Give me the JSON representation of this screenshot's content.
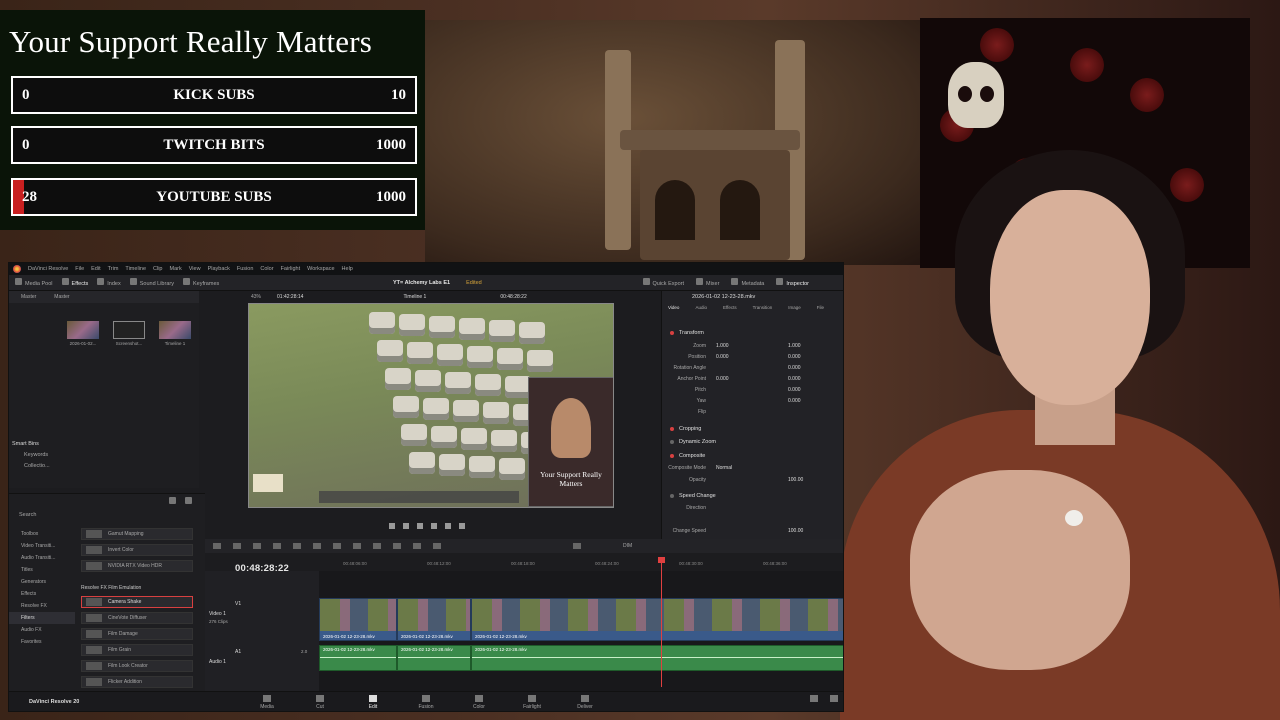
{
  "overlay": {
    "title": "Your Support Really Matters",
    "goals": [
      {
        "current": "0",
        "label": "KICK SUBS",
        "max": "10",
        "progress": 0.0
      },
      {
        "current": "0",
        "label": "TWITCH BITS",
        "max": "1000",
        "progress": 0.0
      },
      {
        "current": "28",
        "label": "YOUTUBE SUBS",
        "max": "1000",
        "progress": 0.028
      }
    ],
    "accent": "#c82020"
  },
  "resolve": {
    "menu": [
      "DaVinci Resolve",
      "File",
      "Edit",
      "Trim",
      "Timeline",
      "Clip",
      "Mark",
      "View",
      "Playback",
      "Fusion",
      "Color",
      "Fairlight",
      "Workspace",
      "Help"
    ],
    "toolbar_left": [
      "Media Pool",
      "Effects",
      "Index",
      "Sound Library",
      "Keyframes"
    ],
    "project": "YT= Alchemy Labs E1",
    "project_status": "Edited",
    "toolbar_right": [
      "Quick Export",
      "Mixer",
      "Metadata",
      "Inspector"
    ],
    "viewer": {
      "zoom": "43%",
      "source_tc": "01:42:28:14",
      "timeline": "Timeline 1",
      "tc": "00:48:28:22"
    },
    "pool_tabs": [
      "Master",
      "Master"
    ],
    "clips": [
      "2026-01-02...",
      "Screenshot...",
      "Timeline 1"
    ],
    "smart_bins": {
      "title": "Smart Bins",
      "items": [
        "Keywords",
        "Collectio..."
      ]
    },
    "effects": {
      "search_placeholder": "Search",
      "categories": [
        "Toolbox",
        "Video Transiti...",
        "Audio Transiti...",
        "Titles",
        "Generators",
        "Effects",
        "Resolve FX",
        "Filters",
        "Audio FX",
        "Favorites"
      ],
      "group": "Resolve FX Film Emulation",
      "items_top": [
        "Gamut Mapping",
        "Invert Color",
        "NVIDIA RTX Video HDR"
      ],
      "items": [
        "Camera Shake",
        "CineVote Diffuser",
        "Film Damage",
        "Film Grain",
        "Film Look Creator",
        "Flicker Addition"
      ]
    },
    "inspector": {
      "file": "2026-01-02 12-23-28.mkv",
      "tabs": [
        "Video",
        "Audio",
        "Effects",
        "Transition",
        "Image",
        "File"
      ],
      "sections": [
        "Transform",
        "Cropping",
        "Dynamic Zoom",
        "Composite",
        "Speed Change"
      ],
      "rows": [
        {
          "k": "Zoom",
          "x": "1.000",
          "y": "1.000"
        },
        {
          "k": "Position",
          "x": "0.000",
          "y": "0.000"
        },
        {
          "k": "Rotation Angle",
          "x": "",
          "y": "0.000"
        },
        {
          "k": "Anchor Point",
          "x": "0.000",
          "y": "0.000"
        },
        {
          "k": "Pitch",
          "x": "",
          "y": "0.000"
        },
        {
          "k": "Yaw",
          "x": "",
          "y": "0.000"
        },
        {
          "k": "Flip",
          "x": "",
          "y": ""
        }
      ],
      "composite_mode_label": "Composite Mode",
      "composite_mode": "Normal",
      "opacity_label": "Opacity",
      "opacity": "100.00",
      "direction_label": "Direction",
      "change_speed_label": "Change Speed",
      "change_speed": "100.00"
    },
    "timeline": {
      "tc": "00:48:28:22",
      "ruler": [
        "00:48:06:00",
        "00:48:12:00",
        "00:48:18:00",
        "00:48:24:00",
        "00:48:30:00",
        "00:48:36:00"
      ],
      "video_track": {
        "id": "V1",
        "name": "Video 1",
        "clips": "276 Clips"
      },
      "audio_track": {
        "id": "A1",
        "name": "Audio 1",
        "level": "2.0"
      },
      "clip_name": "2026-01-02 12-23-28.mkv",
      "dim": "DIM"
    },
    "pages": [
      "Media",
      "Cut",
      "Edit",
      "Fusion",
      "Color",
      "Fairlight",
      "Deliver"
    ],
    "active_page": "Edit",
    "brand": "DaVinci Resolve 20"
  }
}
